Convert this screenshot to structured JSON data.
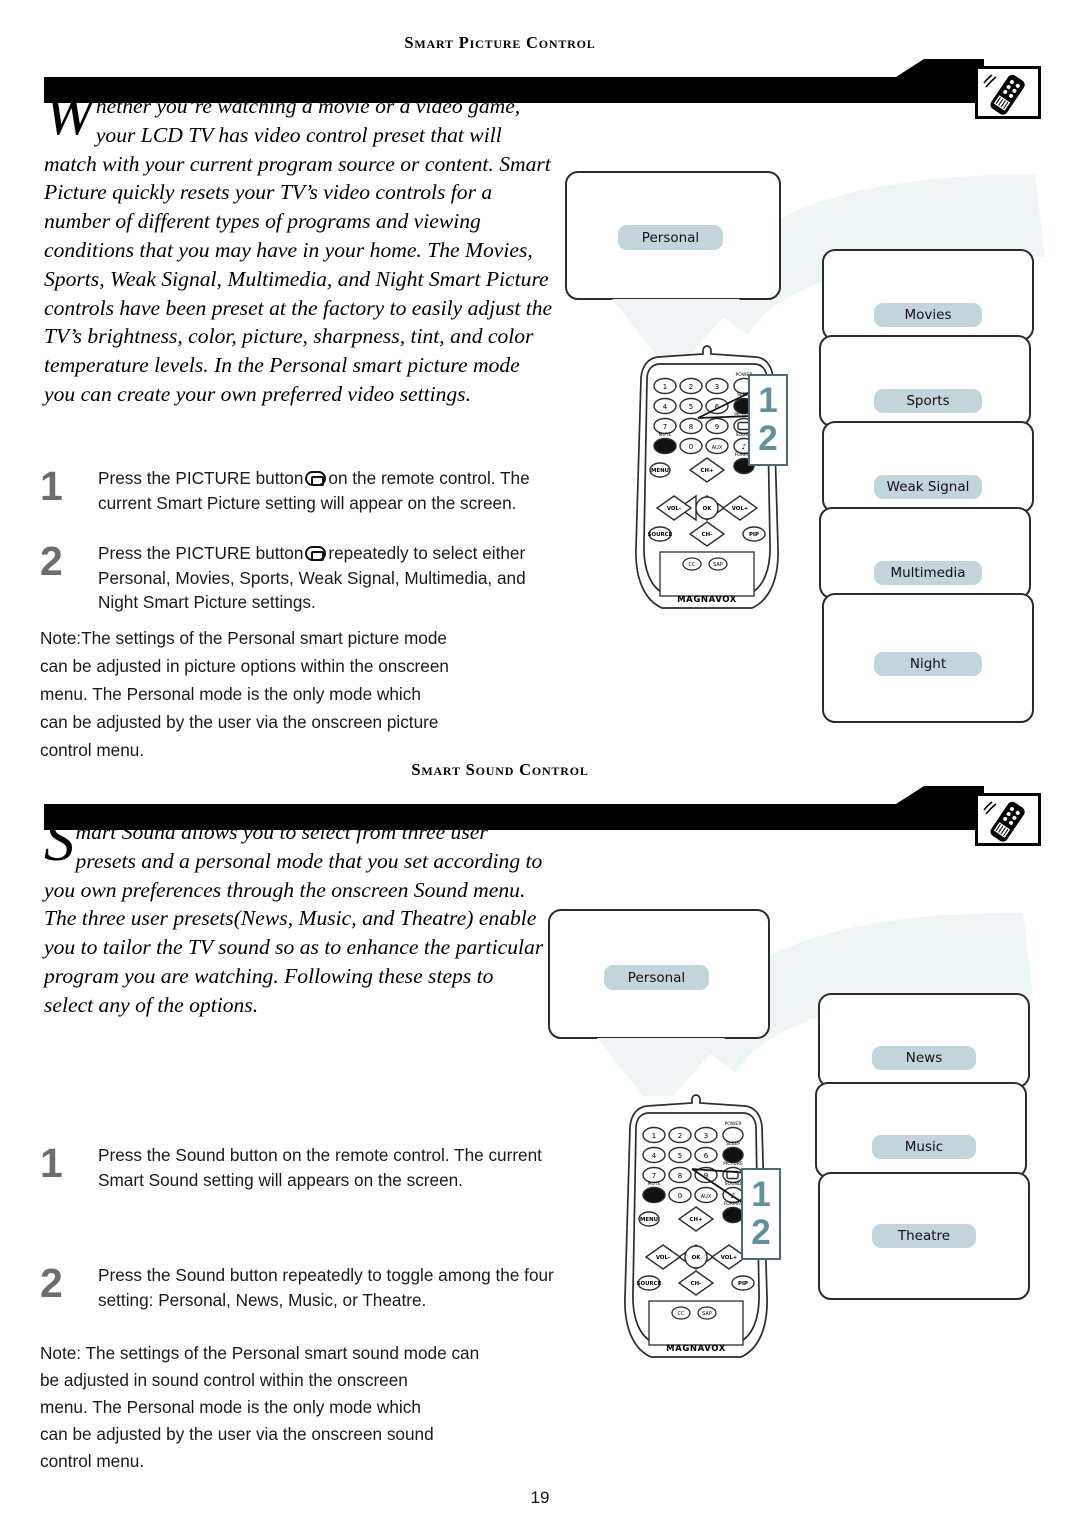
{
  "page": {
    "number": "19"
  },
  "sections": [
    {
      "id": "smart-picture",
      "heading": "Smart Picture Control",
      "intro_dropcap": "W",
      "intro_text": "hether you’re watching a movie or a video game, your LCD TV has video control preset that will match with your current program source or content. Smart Picture quickly resets your TV’s video controls for a number of different types of programs and viewing conditions that you may have in your home. The Movies, Sports, Weak Signal, Multimedia, and Night Smart Picture controls have been preset at the factory to easily adjust the TV’s brightness, color, picture, sharpness, tint, and color temperature levels. In the Personal smart picture mode you can create your own preferred video settings.",
      "steps": [
        {
          "number": "1",
          "text_before": "Press the PICTURE button",
          "text_after": "on the remote control. The current Smart Picture setting will appear on the screen."
        },
        {
          "number": "2",
          "text_before": "Press the PICTURE button",
          "text_after": "repeatedly to select either Personal, Movies, Sports, Weak Signal, Multimedia, and Night Smart Picture settings."
        }
      ],
      "note": "Note:The settings of the Personal smart picture mode\ncan be adjusted in picture options within the onscreen\nmenu. The Personal mode is the only mode which\ncan be adjusted by the user via the onscreen picture\ncontrol menu.",
      "diagram": {
        "screen_label": "Personal",
        "callout_numbers": [
          "1",
          "2"
        ],
        "remote_brand": "MAGNAVOX",
        "options": [
          "Movies",
          "Sports",
          "Weak Signal",
          "Multimedia",
          "Night"
        ]
      }
    },
    {
      "id": "smart-sound",
      "heading": "Smart Sound Control",
      "intro_dropcap": "S",
      "intro_text": "mart Sound allows you to select from three user presets and a personal mode that you set according to you own preferences through the onscreen Sound menu. The three user presets(News, Music, and Theatre) enable you to tailor the TV sound so as to enhance the particular program you are watching. Following these steps to select any of the options.",
      "steps": [
        {
          "number": "1",
          "text_before": "Press the Sound button on the remote control. The current Smart Sound setting will appears on the screen.",
          "text_after": ""
        },
        {
          "number": "2",
          "text_before": "Press the Sound button repeatedly to toggle among the four setting: Personal, News, Music, or Theatre.",
          "text_after": ""
        }
      ],
      "note": "Note: The settings of the Personal smart sound mode can\n          be adjusted in sound control within the onscreen\n          menu. The Personal  mode is the only mode which\n          can be adjusted by the user via the onscreen sound\n          control menu.",
      "diagram": {
        "screen_label": "Personal",
        "callout_numbers": [
          "1",
          "2"
        ],
        "remote_brand": "MAGNAVOX",
        "options": [
          "News",
          "Music",
          "Theatre"
        ]
      }
    }
  ],
  "remote": {
    "keypad": [
      "1",
      "2",
      "3",
      "4",
      "5",
      "6",
      "7",
      "8",
      "9",
      "0"
    ],
    "side_labels": [
      "POWER",
      "SLEEP",
      "PICTURE",
      "SOUND",
      "FORMAT"
    ],
    "buttons": [
      "MUTE",
      "AUX",
      "MENU",
      "CH+",
      "VOL-",
      "OK",
      "VOL+",
      "SOURCE",
      "CH-",
      "PIP",
      "CC",
      "SAP"
    ]
  },
  "colors": {
    "pill_bg": "#c3d5da",
    "callout_text": "#63909c",
    "callout_border": "#4a6a74",
    "step_number": "#6d6d6d",
    "outline": "#2c2c2c"
  }
}
